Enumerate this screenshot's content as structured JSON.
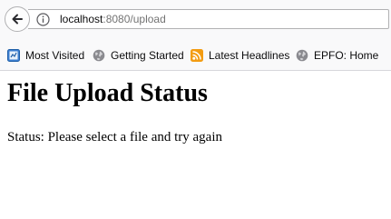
{
  "browser": {
    "url_host": "localhost",
    "url_rest": ":8080/upload",
    "back_icon": "back-arrow-icon",
    "info_icon": "info-icon"
  },
  "bookmarks": [
    {
      "label": "Most Visited",
      "icon": "most-visited-icon"
    },
    {
      "label": "Getting Started",
      "icon": "globe-icon"
    },
    {
      "label": "Latest Headlines",
      "icon": "rss-feed-icon"
    },
    {
      "label": "EPFO: Home",
      "icon": "globe-icon"
    }
  ],
  "page": {
    "title": "File Upload Status",
    "status": "Status: Please select a file and try again"
  },
  "colors": {
    "toolbar_bg": "#f9f9fa",
    "url_host": "#0c0c0d",
    "url_path": "#737373",
    "rss_orange": "#f39c12"
  }
}
